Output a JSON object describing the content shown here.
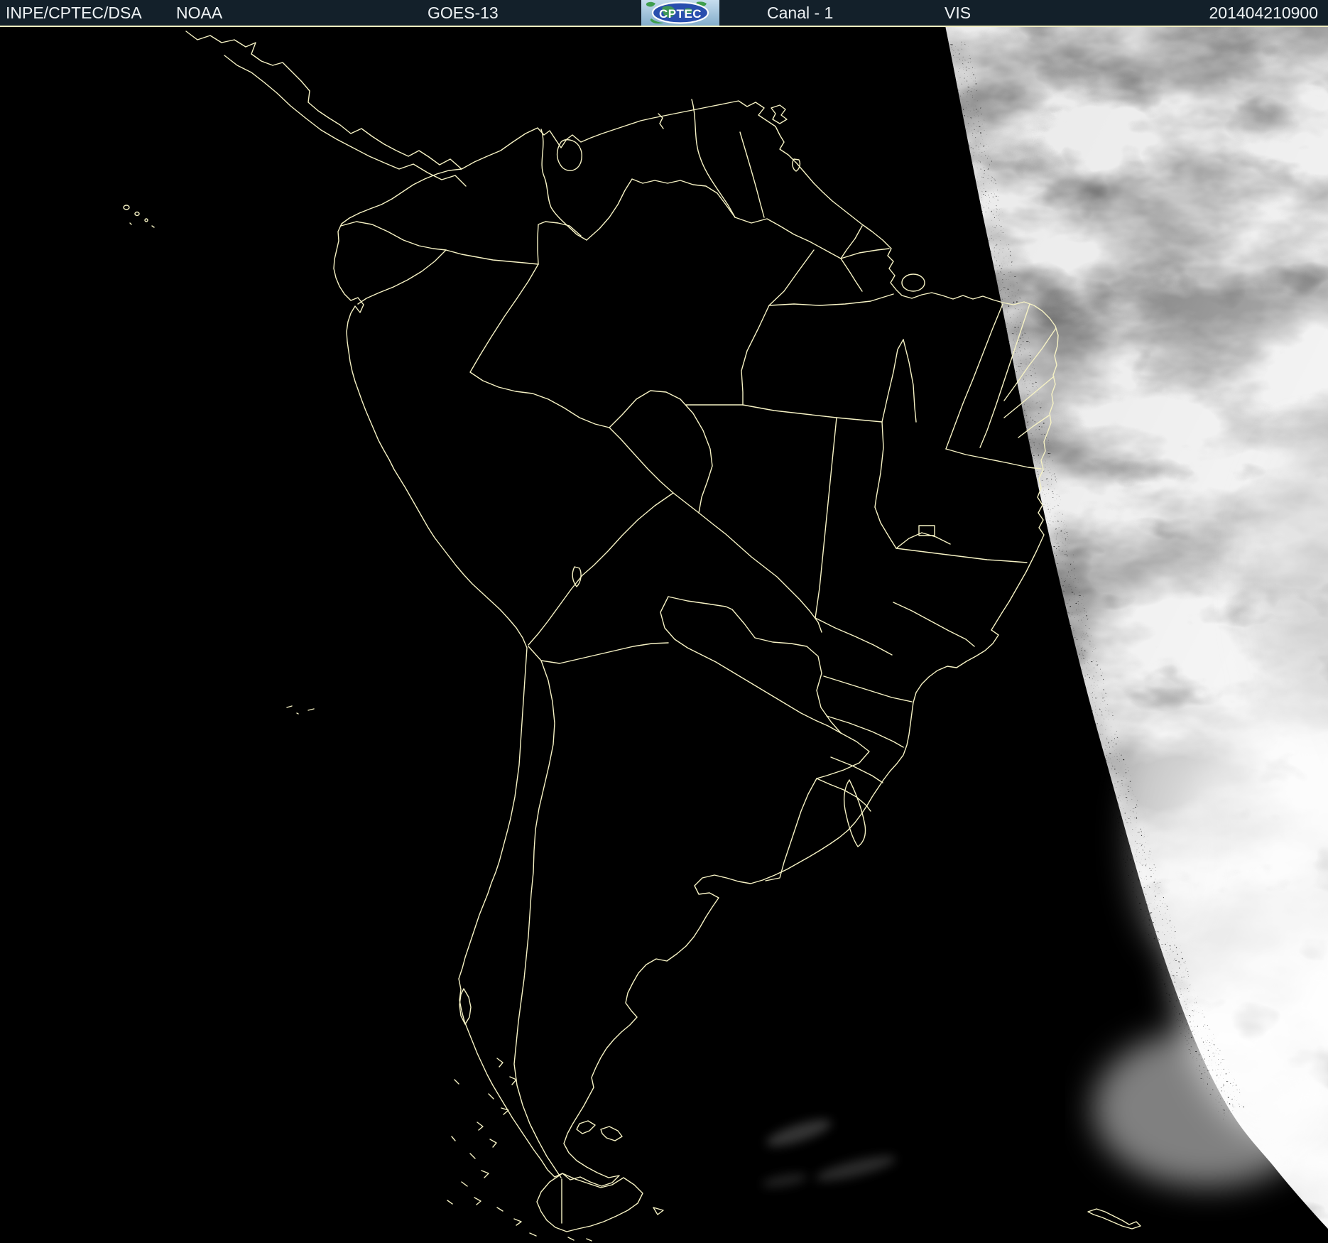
{
  "header": {
    "source": "INPE/CPTEC/DSA",
    "agency": "NOAA",
    "satellite": "GOES-13",
    "logo_text": "CPTEC",
    "channel": "Canal - 1",
    "band": "VIS",
    "timestamp": "201404210900"
  },
  "colors": {
    "header_bg": "#13202a",
    "header_text": "#eef2f4",
    "map_outline": "#f6f2c4",
    "space_bg": "#000000",
    "separator": "#f2eec0",
    "logo_bg_top": "#c6ddee",
    "logo_bg_bottom": "#84aecb",
    "logo_ellipse": "#2a4fae",
    "logo_land": "#3f9e4e",
    "day_dark": "#7c7c7c",
    "day_mid": "#8f8f8f",
    "day_bright": "#f2f2f2"
  }
}
